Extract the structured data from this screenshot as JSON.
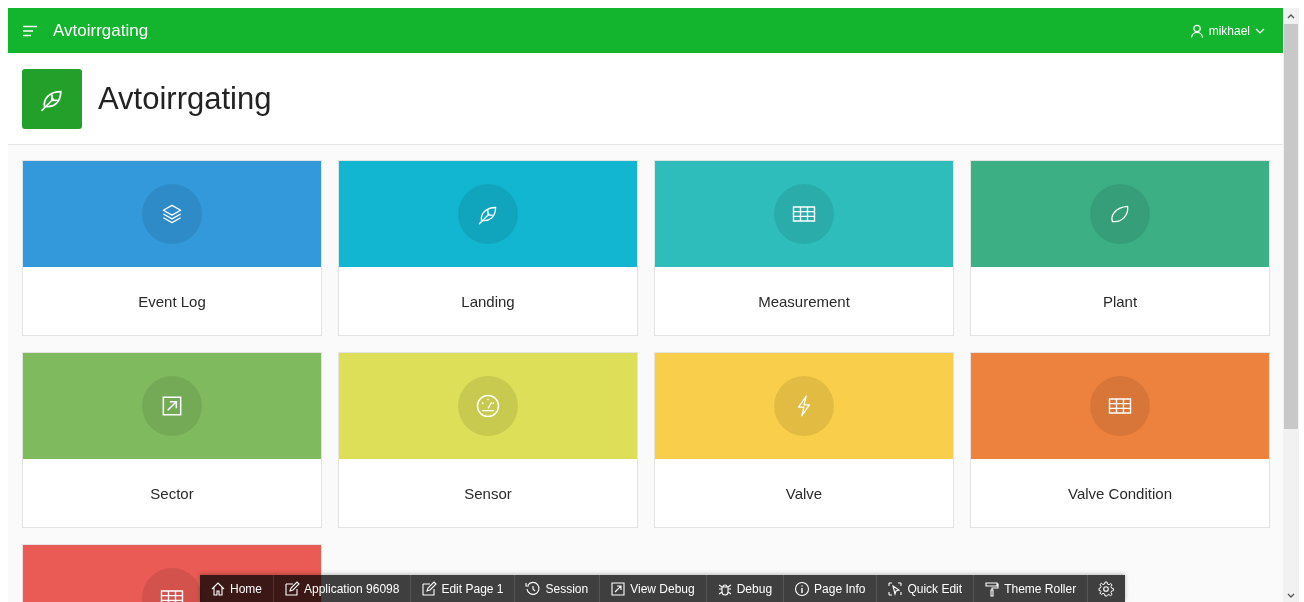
{
  "top_bar": {
    "app_title": "Avtoirrgating",
    "user": "mikhael"
  },
  "page_title": "Avtoirrgating",
  "cards": [
    {
      "label": "Event Log",
      "color": "#3399db"
    },
    {
      "label": "Landing",
      "color": "#13b6d0"
    },
    {
      "label": "Measurement",
      "color": "#2ebdbb"
    },
    {
      "label": "Plant",
      "color": "#3caf85"
    },
    {
      "label": "Sector",
      "color": "#80ba5f"
    },
    {
      "label": "Sensor",
      "color": "#dcdf57"
    },
    {
      "label": "Valve",
      "color": "#f9ce4a"
    },
    {
      "label": "Valve Condition",
      "color": "#ed823e"
    },
    {
      "color": "#e95b54"
    }
  ],
  "dev_toolbar": [
    "Home",
    "Application 96098",
    "Edit Page 1",
    "Session",
    "View Debug",
    "Debug",
    "Page Info",
    "Quick Edit",
    "Theme Roller"
  ]
}
